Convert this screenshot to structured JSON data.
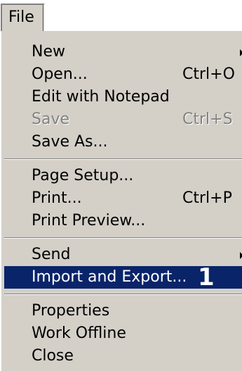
{
  "menubar": {
    "file_label": "File"
  },
  "menu": {
    "items": [
      {
        "label": "New",
        "shortcut": "",
        "submenu": true,
        "enabled": true
      },
      {
        "label": "Open...",
        "shortcut": "Ctrl+O",
        "submenu": false,
        "enabled": true
      },
      {
        "label": "Edit with Notepad",
        "shortcut": "",
        "submenu": false,
        "enabled": true
      },
      {
        "label": "Save",
        "shortcut": "Ctrl+S",
        "submenu": false,
        "enabled": false
      },
      {
        "label": "Save As...",
        "shortcut": "",
        "submenu": false,
        "enabled": true
      },
      {
        "label": "Page Setup...",
        "shortcut": "",
        "submenu": false,
        "enabled": true
      },
      {
        "label": "Print...",
        "shortcut": "Ctrl+P",
        "submenu": false,
        "enabled": true
      },
      {
        "label": "Print Preview...",
        "shortcut": "",
        "submenu": false,
        "enabled": true
      },
      {
        "label": "Send",
        "shortcut": "",
        "submenu": true,
        "enabled": true
      },
      {
        "label": "Import and Export...",
        "shortcut": "",
        "submenu": false,
        "enabled": true,
        "selected": true,
        "badge": "1"
      },
      {
        "label": "Properties",
        "shortcut": "",
        "submenu": false,
        "enabled": true
      },
      {
        "label": "Work Offline",
        "shortcut": "",
        "submenu": false,
        "enabled": true
      },
      {
        "label": "Close",
        "shortcut": "",
        "submenu": false,
        "enabled": true
      }
    ]
  },
  "colors": {
    "menu_background": "#d4d0c8",
    "highlight": "#0a246a",
    "highlight_text": "#ffffff",
    "disabled_text": "#808080"
  }
}
